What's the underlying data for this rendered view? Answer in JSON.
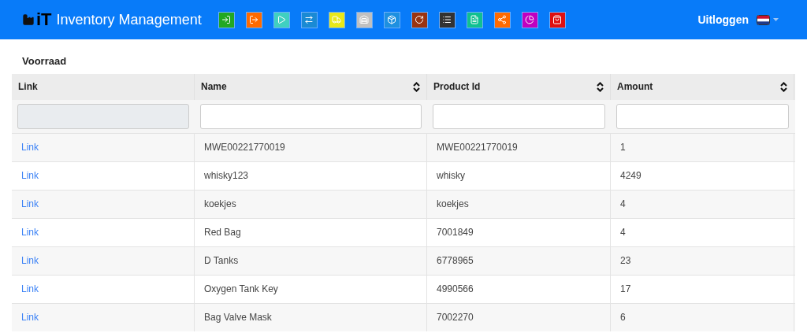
{
  "navbar": {
    "brand_mark": "iT",
    "title": "Inventory Management",
    "toolbar": [
      {
        "kind": "login",
        "color": "#22a822"
      },
      {
        "kind": "logout",
        "color": "#ff6a00"
      },
      {
        "kind": "play",
        "color": "#40d0c0"
      },
      {
        "kind": "transfer",
        "color": "#1a8ad4"
      },
      {
        "kind": "truck",
        "color": "#e8e818"
      },
      {
        "kind": "warehouse",
        "color": "#c0c0c0"
      },
      {
        "kind": "box",
        "color": "#1e90e0"
      },
      {
        "kind": "refresh",
        "color": "#9a3412"
      },
      {
        "kind": "list",
        "color": "#333333"
      },
      {
        "kind": "file",
        "color": "#10c090"
      },
      {
        "kind": "share",
        "color": "#ff6a00"
      },
      {
        "kind": "chart",
        "color": "#c000c0"
      },
      {
        "kind": "bag",
        "color": "#e01010"
      }
    ],
    "logout": "Uitloggen"
  },
  "heading": "Voorraad",
  "table": {
    "columns": [
      {
        "label": "Link",
        "sortable": false,
        "filter_disabled": true
      },
      {
        "label": "Name",
        "sortable": true,
        "filter_disabled": false
      },
      {
        "label": "Product Id",
        "sortable": true,
        "filter_disabled": false
      },
      {
        "label": "Amount",
        "sortable": true,
        "filter_disabled": false
      }
    ],
    "rows": [
      [
        "Link",
        "MWE00221770019",
        "MWE00221770019",
        "1"
      ],
      [
        "Link",
        "whisky123",
        "whisky",
        "4249"
      ],
      [
        "Link",
        "koekjes",
        "koekjes",
        "4"
      ],
      [
        "Link",
        "Red Bag",
        "7001849",
        "4"
      ],
      [
        "Link",
        "D Tanks",
        "6778965",
        "23"
      ],
      [
        "Link",
        "Oxygen Tank Key",
        "4990566",
        "17"
      ],
      [
        "Link",
        "Bag Valve Mask",
        "7002270",
        "6"
      ]
    ]
  }
}
